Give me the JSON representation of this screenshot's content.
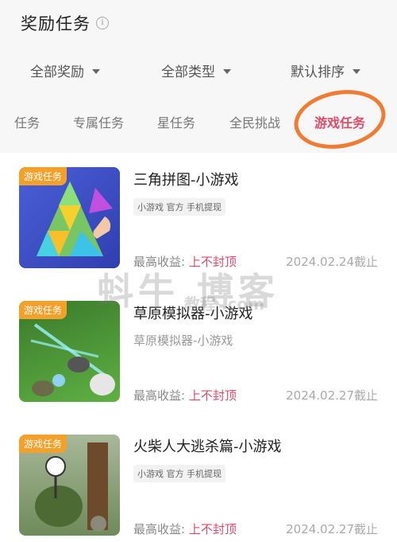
{
  "header": {
    "title": "奖励任务",
    "info_icon": "info-icon"
  },
  "filters": [
    {
      "label": "全部奖励"
    },
    {
      "label": "全部类型"
    },
    {
      "label": "默认排序"
    }
  ],
  "tabs": [
    {
      "label": "任务",
      "active": false
    },
    {
      "label": "专属任务",
      "active": false
    },
    {
      "label": "星任务",
      "active": false
    },
    {
      "label": "全民挑战",
      "active": false
    },
    {
      "label": "游戏任务",
      "active": true
    }
  ],
  "items": [
    {
      "badge": "游戏任务",
      "title": "三角拼图-小游戏",
      "tags": "小游戏 官方 手机提现",
      "income_label": "最高收益:",
      "income_value": "上不封顶",
      "deadline": "2024.02.24截止"
    },
    {
      "badge": "游戏任务",
      "title": "草原模拟器-小游戏",
      "subtitle": "草原模拟器-小游戏",
      "income_label": "最高收益:",
      "income_value": "上不封顶",
      "deadline": "2024.02.27截止"
    },
    {
      "badge": "游戏任务",
      "title": "火柴人大逃杀篇-小游戏",
      "tags": "小游戏 官方 手机提现",
      "income_label": "最高收益:",
      "income_value": "上不封顶",
      "deadline": "2024.02.27截止"
    }
  ],
  "watermark": {
    "main": "蚪牛 博客",
    "sub": "教程 .com"
  },
  "colors": {
    "accent": "#e24a6a",
    "badge": "#f4a12b",
    "annotation_circle": "#f07c34"
  }
}
